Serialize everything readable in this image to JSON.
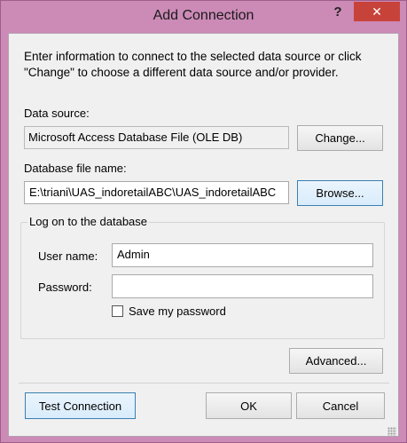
{
  "window": {
    "title": "Add Connection",
    "help_label": "?",
    "close_label": "✕"
  },
  "intro_text": "Enter information to connect to the selected data source or click \"Change\" to choose a different data source and/or provider.",
  "data_source": {
    "label": "Data source:",
    "value": "Microsoft Access Database File (OLE DB)",
    "change_button": "Change..."
  },
  "database_file": {
    "label": "Database file name:",
    "value": "E:\\triani\\UAS_indoretailABC\\UAS_indoretailABC",
    "browse_button": "Browse..."
  },
  "logon": {
    "legend": "Log on to the database",
    "username_label": "User name:",
    "username_value": "Admin",
    "password_label": "Password:",
    "password_value": "",
    "save_password_label": "Save my password",
    "save_password_checked": false
  },
  "buttons": {
    "advanced": "Advanced...",
    "test_connection": "Test Connection",
    "ok": "OK",
    "cancel": "Cancel"
  }
}
